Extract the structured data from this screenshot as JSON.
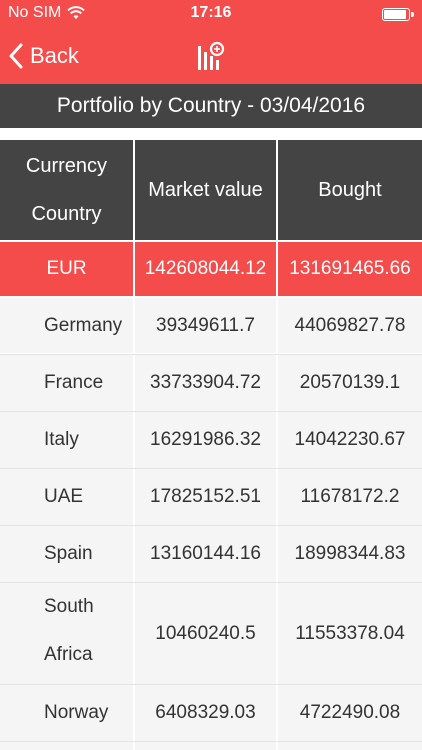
{
  "status_bar": {
    "carrier": "No SIM",
    "time": "17:16"
  },
  "nav": {
    "back_label": "Back",
    "logo_icon": "portfolio-chart-icon"
  },
  "title": "Portfolio by Country - 03/04/2016",
  "table": {
    "columns": {
      "col1_line1": "Currency",
      "col1_line2": "Country",
      "market_value": "Market value",
      "bought": "Bought"
    },
    "currency_row": {
      "currency": "EUR",
      "market_value": "142608044.12",
      "bought": "131691465.66"
    },
    "rows": [
      {
        "country": "Germany",
        "market_value": "39349611.7",
        "bought": "44069827.78"
      },
      {
        "country": "France",
        "market_value": "33733904.72",
        "bought": "20570139.1"
      },
      {
        "country": "Italy",
        "market_value": "16291986.32",
        "bought": "14042230.67"
      },
      {
        "country": "UAE",
        "market_value": "17825152.51",
        "bought": "11678172.2"
      },
      {
        "country": "Spain",
        "market_value": "13160144.16",
        "bought": "18998344.83"
      },
      {
        "country_line1": "South",
        "country_line2": "Africa",
        "market_value": "10460240.5",
        "bought": "11553378.04"
      },
      {
        "country": "Norway",
        "market_value": "6408329.03",
        "bought": "4722490.08"
      }
    ]
  },
  "colors": {
    "accent_red": "#f44b4b",
    "header_dark": "#444444",
    "row_background": "#f5f5f5"
  }
}
